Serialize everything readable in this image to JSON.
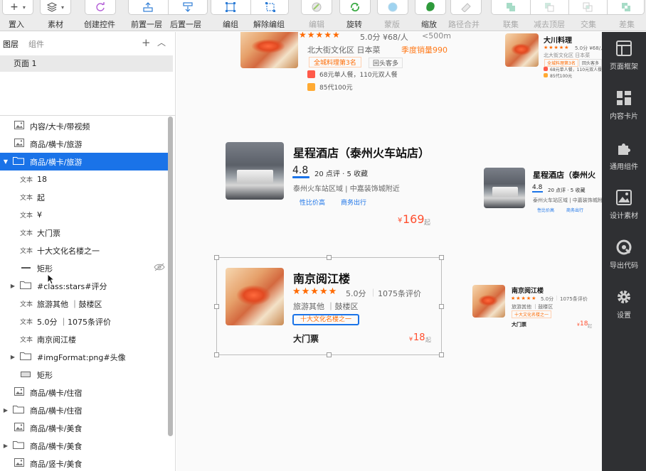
{
  "toolbar": {
    "items": [
      {
        "label": "置入"
      },
      {
        "label": "素材"
      },
      {
        "label": "创建控件"
      },
      {
        "label": "前置一层"
      },
      {
        "label": "后置一层"
      },
      {
        "label": "编组"
      },
      {
        "label": "解除编组"
      },
      {
        "label": "编辑"
      },
      {
        "label": "旋转"
      },
      {
        "label": "蒙版"
      },
      {
        "label": "缩放"
      },
      {
        "label": "路径合并"
      },
      {
        "label": "联集"
      },
      {
        "label": "减去顶层"
      },
      {
        "label": "交集"
      },
      {
        "label": "差集"
      }
    ]
  },
  "leftpanel": {
    "tabs": {
      "layers": "图层",
      "components": "组件"
    },
    "page": "页面 1",
    "layers": [
      {
        "type": "image",
        "label": "内容/大卡/带视频"
      },
      {
        "type": "image",
        "label": "商品/横卡/旅游"
      },
      {
        "type": "folder",
        "label": "商品/横卡/旅游"
      },
      {
        "type": "text",
        "tag": "文本",
        "label": "18"
      },
      {
        "type": "text",
        "tag": "文本",
        "label": "起"
      },
      {
        "type": "text",
        "tag": "文本",
        "label": "¥"
      },
      {
        "type": "text",
        "tag": "文本",
        "label": "大门票"
      },
      {
        "type": "text",
        "tag": "文本",
        "label": "十大文化名楼之一"
      },
      {
        "type": "rect",
        "label": "矩形"
      },
      {
        "type": "folder",
        "label": "#class:stars#评分"
      },
      {
        "type": "text",
        "tag": "文本",
        "label": "旅游其他 ｜鼓楼区"
      },
      {
        "type": "text",
        "tag": "文本",
        "label": "5.0分 ｜1075条评价"
      },
      {
        "type": "text",
        "tag": "文本",
        "label": "南京阅江楼"
      },
      {
        "type": "folder",
        "label": "#imgFormat:png#头像"
      },
      {
        "type": "rect",
        "label": "矩形"
      },
      {
        "type": "image",
        "label": "商品/横卡/住宿"
      },
      {
        "type": "folder",
        "label": "商品/横卡/住宿"
      },
      {
        "type": "image",
        "label": "商品/横卡/美食"
      },
      {
        "type": "folder",
        "label": "商品/横卡/美食"
      },
      {
        "type": "image",
        "label": "商品/竖卡/美食"
      }
    ]
  },
  "canvas": {
    "card1": {
      "rating": "5.0分 ¥68/人",
      "distance": "<500m",
      "area": "北大街文化区 日本菜",
      "sales": "季度销量990",
      "rank": "全城料理第3名",
      "tag2": "回头客多",
      "deal1": "68元单人餐，110元双人餐",
      "deal2": "85代100元"
    },
    "card1_small": {
      "title": "大川料理",
      "rating": "5.0分 ¥68/人",
      "area": "北大街文化区  日本菜",
      "rank": "全城料理第3名",
      "tag2": "回头客多",
      "deal1": "68元单人餐，110元双人餐",
      "deal2": "85代100元"
    },
    "card2": {
      "title": "星程酒店（泰州火车站店）",
      "score": "4.8",
      "meta": "20 点评 · 5 收藏",
      "area": "泰州火车站区域 | 中嘉装饰城附近",
      "tag1": "性比价高",
      "tag2": "商务出行",
      "price_symbol": "¥",
      "price": "169",
      "price_suffix": "起"
    },
    "card2_small": {
      "title": "星程酒店（泰州火",
      "score": "4.8",
      "meta": "20 点评 · 5 收藏",
      "area": "泰州火车站区域 | 中嘉装饰城附近",
      "tag1": "性比价高",
      "tag2": "商务出行"
    },
    "card3": {
      "title": "南京阅江楼",
      "rating": "5.0分",
      "reviews": "1075条评价",
      "area": "旅游其他 ｜鼓楼区",
      "badge": "十大文化名楼之一",
      "ticket": "大门票",
      "price_symbol": "¥",
      "price": "18",
      "price_suffix": "起"
    },
    "card3_small": {
      "title": "南京阅江楼",
      "rating": "5.0分",
      "reviews": "1075条评价",
      "area": "旅游其他 ｜鼓楼区",
      "badge": "十大文化名楼之一",
      "ticket": "大门票",
      "price_symbol": "¥",
      "price": "18",
      "price_suffix": "起"
    },
    "stars": "★★★★★",
    "separator": "｜"
  },
  "rightpanel": {
    "items": [
      {
        "label": "页面框架",
        "icon": "layout-icon"
      },
      {
        "label": "内容卡片",
        "icon": "cards-icon"
      },
      {
        "label": "通用组件",
        "icon": "puzzle-icon"
      },
      {
        "label": "设计素材",
        "icon": "image-icon"
      },
      {
        "label": "导出代码",
        "icon": "export-icon"
      },
      {
        "label": "设置",
        "icon": "gear-icon"
      }
    ]
  },
  "colors": {
    "accent": "#1a73e8",
    "price": "#ff4d2d",
    "star": "#ff6a00",
    "sidebar": "#2f3033"
  }
}
